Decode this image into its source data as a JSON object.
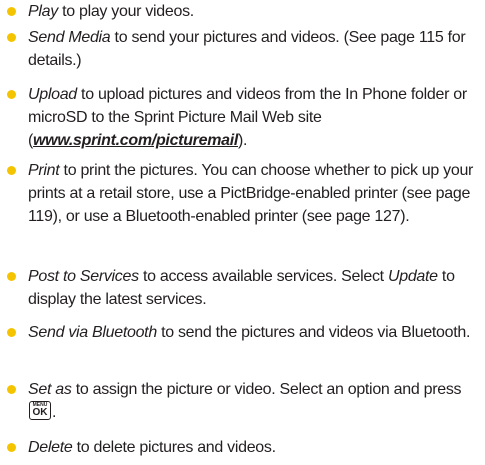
{
  "colors": {
    "bullet": "#f5c400",
    "text": "#231f20"
  },
  "items": [
    {
      "term": "Play",
      "text": " to play your videos."
    },
    {
      "term": "Send Media",
      "text": " to send your pictures and videos. (See page 115 for details.)"
    },
    {
      "term": "Upload",
      "text": " to upload pictures and videos from the In Phone folder or microSD to the Sprint Picture Mail Web site (",
      "link": "www.sprint.com/picturemail",
      "text_after": ")."
    },
    {
      "term": "Print",
      "text": " to print the pictures. You can choose whether to pick up your prints at a retail store, use a PictBridge-enabled printer (see page 119), or use a Bluetooth-enabled printer (see page 127)."
    },
    {
      "term": "Post to Services",
      "text": " to access available services. Select ",
      "term2": "Update",
      "text_after": " to display the latest services."
    },
    {
      "term": "Send via Bluetooth",
      "text": " to send the pictures and videos via Bluetooth."
    },
    {
      "term": "Set as",
      "text": " to assign the picture or video. Select an option and press ",
      "key_menu": "MENU",
      "key_ok": "OK",
      "text_after": "."
    },
    {
      "term": "Delete",
      "text": " to delete pictures and videos."
    }
  ]
}
